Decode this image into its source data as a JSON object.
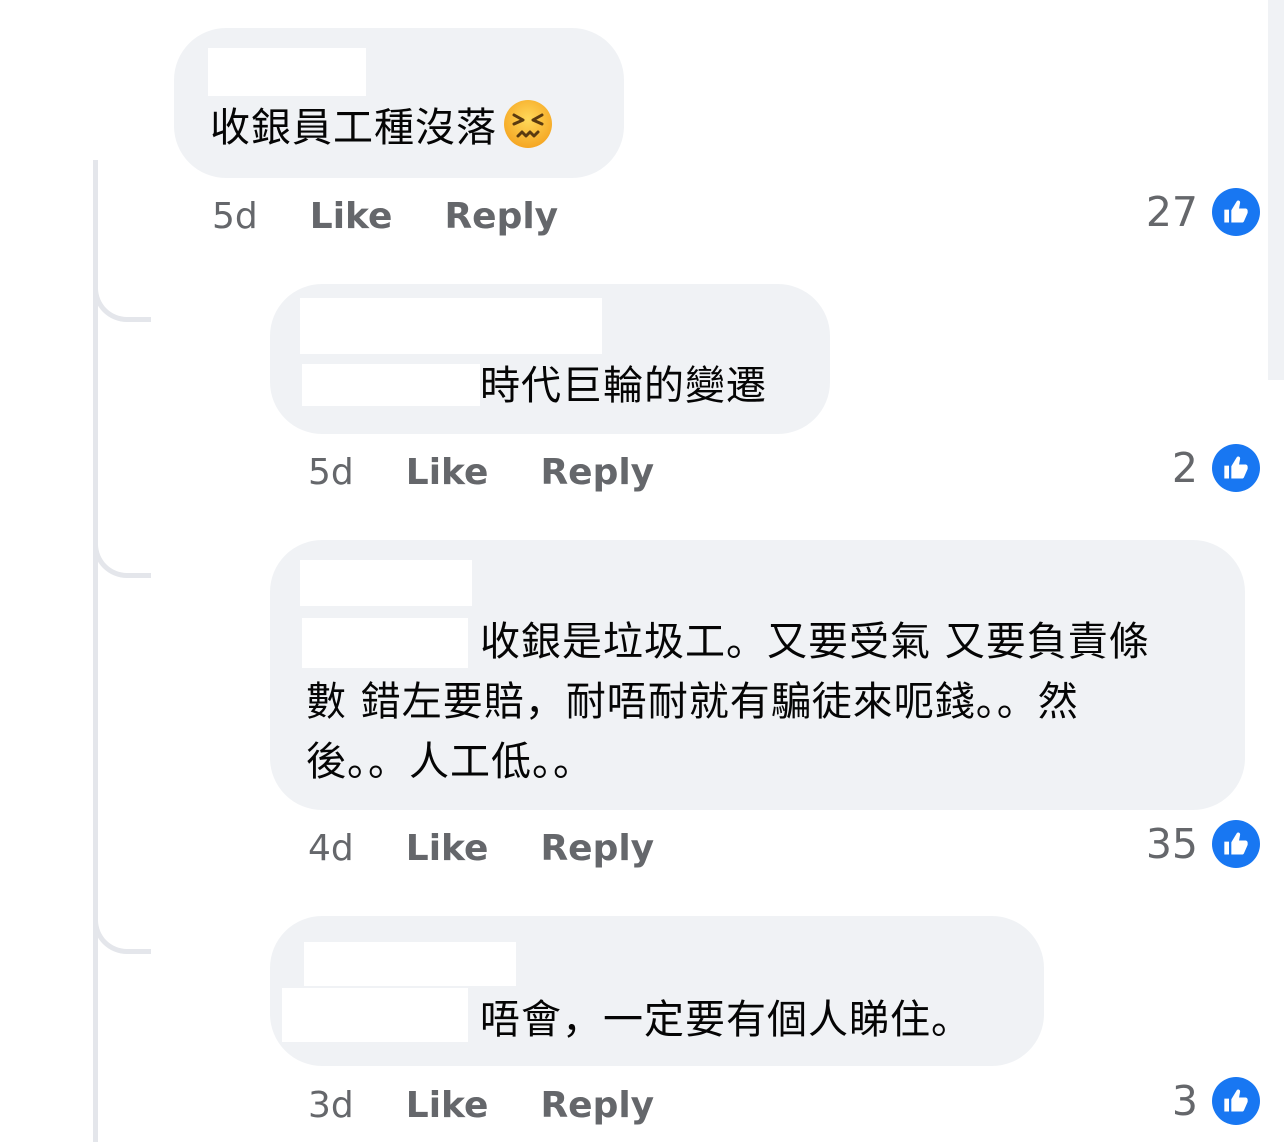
{
  "comments": [
    {
      "text": "收銀員工種沒落",
      "emoji": "confounded-face-emoji",
      "time": "5d",
      "like_label": "Like",
      "reply_label": "Reply",
      "reactions": "27"
    },
    {
      "text": "時代巨輪的變遷",
      "time": "5d",
      "like_label": "Like",
      "reply_label": "Reply",
      "reactions": "2"
    },
    {
      "text_line1": "收銀是垃圾工。又要受氣 又要負責條",
      "text_line2": "數 錯左要賠，耐唔耐就有騙徒來呃錢。。然",
      "text_line3": "後。。人工低。。",
      "time": "4d",
      "like_label": "Like",
      "reply_label": "Reply",
      "reactions": "35"
    },
    {
      "text": "唔會，一定要有個人睇住。",
      "time": "3d",
      "like_label": "Like",
      "reply_label": "Reply",
      "reactions": "3"
    }
  ],
  "colors": {
    "bubble": "#f0f2f5",
    "meta_text": "#65676b",
    "like_blue": "#1877f2",
    "thread_line": "#e4e6eb"
  }
}
